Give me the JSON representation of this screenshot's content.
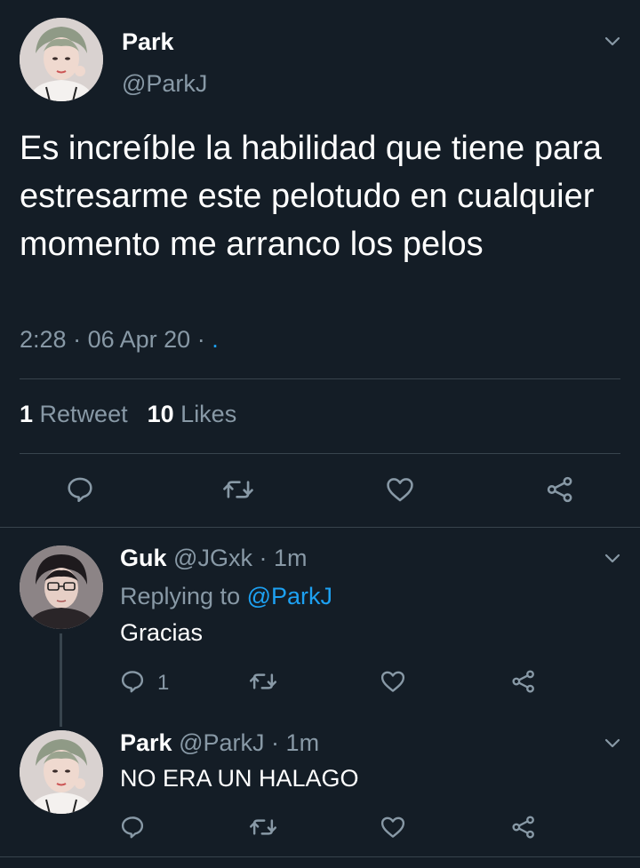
{
  "main_tweet": {
    "display_name": "Park",
    "handle": "@ParkJ",
    "text": "Es increíble la habilidad que tiene para estresarme este pelotudo en cualquier momento me arranco los pelos",
    "time": "2:28",
    "date": "06 Apr 20",
    "source": ".",
    "stats": {
      "retweets_count": "1",
      "retweets_label": "Retweet",
      "likes_count": "10",
      "likes_label": "Likes"
    }
  },
  "replies": [
    {
      "display_name": "Guk",
      "handle": "@JGxk",
      "time": "1m",
      "replying_prefix": "Replying to",
      "replying_to": "@ParkJ",
      "text": "Gracias",
      "reply_count": "1"
    },
    {
      "display_name": "Park",
      "handle": "@ParkJ",
      "time": "1m",
      "text": "NO ERA UN HALAGO"
    }
  ],
  "separator": "·",
  "colors": {
    "background": "#141d26",
    "text": "#ffffff",
    "secondary": "#8899a6",
    "accent": "#1da1f2",
    "divider": "#38444d"
  },
  "icons": [
    "reply-icon",
    "retweet-icon",
    "like-icon",
    "share-icon",
    "chevron-down-icon"
  ]
}
